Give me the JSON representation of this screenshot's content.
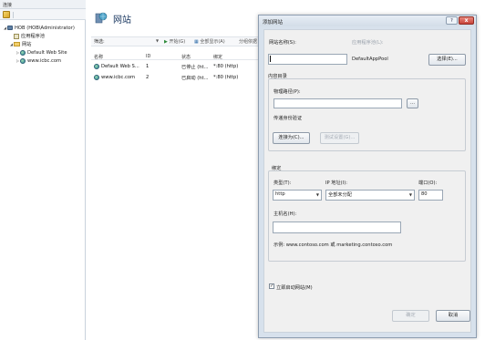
{
  "connections": {
    "header": "连接",
    "tree": [
      {
        "label": "HOB (HOB\\Administrator)",
        "level": 0,
        "expander": "◢",
        "icon": "server-icon"
      },
      {
        "label": "应用程序池",
        "level": 1,
        "expander": "",
        "icon": "app-pool-icon"
      },
      {
        "label": "网站",
        "level": 1,
        "expander": "◢",
        "icon": "sites-folder-icon"
      },
      {
        "label": "Default Web Site",
        "level": 2,
        "expander": "▷",
        "icon": "globe-icon"
      },
      {
        "label": "www.icbc.com",
        "level": 2,
        "expander": "▷",
        "icon": "globe-icon"
      }
    ]
  },
  "sites": {
    "title": "网站",
    "filter_label": "筛选:",
    "go_label": "开始(G)",
    "show_all_label": "全部显示(A)",
    "group_label": "分组依据",
    "columns": [
      "名称",
      "ID",
      "状态",
      "绑定"
    ],
    "rows": [
      {
        "name": "Default Web S...",
        "id": "1",
        "status": "已停止 (ht...",
        "binding": "*:80 (http)"
      },
      {
        "name": "www.icbc.com",
        "id": "2",
        "status": "已启动 (ht...",
        "binding": "*:80 (http)"
      }
    ]
  },
  "dialog": {
    "title": "添加网站",
    "help_glyph": "?",
    "close_glyph": "x",
    "site_name_label": "网站名称(S):",
    "site_name_value": "",
    "app_pool_label": "应用程序池(L):",
    "app_pool_value": "DefaultAppPool",
    "select_button": "选择(E)...",
    "content_dir_label": "内容目录",
    "physical_path_label": "物理路径(P):",
    "physical_path_value": "",
    "browse_button": "...",
    "passthrough_label": "传递身份验证",
    "connect_as_button": "连接为(C)...",
    "test_settings_button": "测试设置(G)...",
    "binding_label": "绑定",
    "type_label": "类型(T):",
    "type_value": "http",
    "ip_label": "IP 地址(I):",
    "ip_value": "全部未分配",
    "port_label": "端口(O):",
    "port_value": "80",
    "hostname_label": "主机名(H):",
    "hostname_value": "",
    "example_text": "示例: www.contoso.com 或 marketing.contoso.com",
    "start_immediately_label": "立即启动网站(M)",
    "start_immediately_checked": true,
    "ok_button": "确定",
    "cancel_button": "取消"
  },
  "colors": {
    "accent_title": "#1e3b63",
    "dialog_frame": "#d7e1ec",
    "close_red": "#c8443a"
  }
}
